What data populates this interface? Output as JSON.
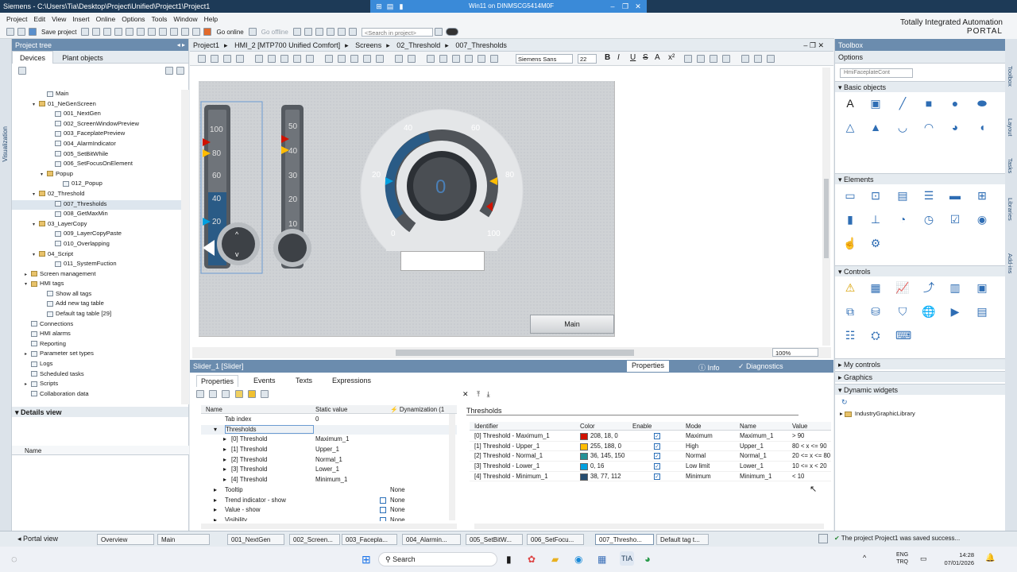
{
  "window": {
    "title": "Siemens - C:\\Users\\Tia\\Desktop\\Project\\Unified\\Project1\\Project1"
  },
  "remote": {
    "title": "Win11 on DINMSCG5414M0F"
  },
  "menu": [
    "Project",
    "Edit",
    "View",
    "Insert",
    "Online",
    "Options",
    "Tools",
    "Window",
    "Help"
  ],
  "toolbar": {
    "save": "Save project",
    "go_online": "Go online",
    "go_offline": "Go offline",
    "search_placeholder": "<Search in project>"
  },
  "brand": {
    "line1": "Totally Integrated Automation",
    "line2": "PORTAL"
  },
  "left_rail": {
    "label": "Visualization"
  },
  "project_tree": {
    "header": "Project tree",
    "tabs": [
      "Devices",
      "Plant objects"
    ],
    "items": [
      {
        "label": "Main",
        "indent": 5
      },
      {
        "label": "01_NeGenScreen",
        "indent": 4,
        "folder": true,
        "exp": "▾"
      },
      {
        "label": "001_NextGen",
        "indent": 6
      },
      {
        "label": "002_ScreenWindowPreview",
        "indent": 6
      },
      {
        "label": "003_FaceplatePreview",
        "indent": 6
      },
      {
        "label": "004_AlarmIndicator",
        "indent": 6
      },
      {
        "label": "005_SetBitWhile",
        "indent": 6
      },
      {
        "label": "006_SetFocusOnElement",
        "indent": 6
      },
      {
        "label": "Popup",
        "indent": 5,
        "folder": true,
        "exp": "▾"
      },
      {
        "label": "012_Popup",
        "indent": 7
      },
      {
        "label": "02_Threshold",
        "indent": 4,
        "folder": true,
        "exp": "▾"
      },
      {
        "label": "007_Thresholds",
        "indent": 6,
        "selected": true
      },
      {
        "label": "008_GetMaxMin",
        "indent": 6
      },
      {
        "label": "03_LayerCopy",
        "indent": 4,
        "folder": true,
        "exp": "▾"
      },
      {
        "label": "009_LayerCopyPaste",
        "indent": 6
      },
      {
        "label": "010_Overlapping",
        "indent": 6
      },
      {
        "label": "04_Script",
        "indent": 4,
        "folder": true,
        "exp": "▾"
      },
      {
        "label": "011_SystemFuction",
        "indent": 6
      },
      {
        "label": "Screen management",
        "indent": 3,
        "folder": true,
        "exp": "▸"
      },
      {
        "label": "HMI tags",
        "indent": 3,
        "folder": true,
        "exp": "▾"
      },
      {
        "label": "Show all tags",
        "indent": 5
      },
      {
        "label": "Add new tag table",
        "indent": 5
      },
      {
        "label": "Default tag table [29]",
        "indent": 5
      },
      {
        "label": "Connections",
        "indent": 3
      },
      {
        "label": "HMI alarms",
        "indent": 3
      },
      {
        "label": "Reporting",
        "indent": 3
      },
      {
        "label": "Parameter set types",
        "indent": 3,
        "exp": "▸"
      },
      {
        "label": "Logs",
        "indent": 3
      },
      {
        "label": "Scheduled tasks",
        "indent": 3
      },
      {
        "label": "Scripts",
        "indent": 3,
        "exp": "▸"
      },
      {
        "label": "Collaboration data",
        "indent": 3
      }
    ]
  },
  "details_view": {
    "header": "Details view",
    "col_name": "Name"
  },
  "breadcrumb": [
    "Project1",
    "HMI_2 [MTP700 Unified Comfort]",
    "Screens",
    "02_Threshold",
    "007_Thresholds"
  ],
  "editor_toolbar": {
    "font": "Siemens Sans",
    "size": "22",
    "zoom": "100%"
  },
  "canvas": {
    "bar1_ticks": [
      "100",
      "80",
      "60",
      "40",
      "20"
    ],
    "bar2_ticks": [
      "50",
      "40",
      "30",
      "20",
      "10"
    ],
    "gauge_ticks": [
      "0",
      "20",
      "40",
      "60",
      "80",
      "100"
    ],
    "gauge_value": "0",
    "main_button": "Main"
  },
  "properties": {
    "selection": "Slider_1 [Slider]",
    "top_tabs": [
      "Properties",
      "Info",
      "Diagnostics"
    ],
    "tabs": [
      "Properties",
      "Events",
      "Texts",
      "Expressions"
    ],
    "grid_headers": [
      "Name",
      "Static value",
      "Dynamization (1"
    ],
    "rows": [
      {
        "name": "Tab index",
        "value": "0",
        "indent": 0
      },
      {
        "name": "Thresholds",
        "value": "",
        "indent": 0,
        "exp": "▾",
        "selected": true
      },
      {
        "name": "[0] Threshold",
        "value": "Maximum_1",
        "indent": 1,
        "exp": "▸"
      },
      {
        "name": "[1] Threshold",
        "value": "Upper_1",
        "indent": 1,
        "exp": "▸"
      },
      {
        "name": "[2] Threshold",
        "value": "Normal_1",
        "indent": 1,
        "exp": "▸"
      },
      {
        "name": "[3] Threshold",
        "value": "Lower_1",
        "indent": 1,
        "exp": "▸"
      },
      {
        "name": "[4] Threshold",
        "value": "Minimum_1",
        "indent": 1,
        "exp": "▸"
      },
      {
        "name": "Tooltip",
        "value": "",
        "dyn": "None",
        "indent": 0,
        "exp": "▸"
      },
      {
        "name": "Trend indicator - show",
        "value": "",
        "dyn": "None",
        "check": true,
        "indent": 0,
        "exp": "▸"
      },
      {
        "name": "Value - show",
        "value": "",
        "dyn": "None",
        "check": true,
        "indent": 0,
        "exp": "▸"
      },
      {
        "name": "Visibility",
        "value": "",
        "dyn": "None",
        "check": true,
        "indent": 0,
        "exp": "▸"
      }
    ],
    "thresholds_title": "Thresholds",
    "th_headers": [
      "Identifier",
      "Color",
      "Enable",
      "Mode",
      "Name",
      "Value"
    ],
    "th_rows": [
      {
        "id": "[0] Threshold - Maximum_1",
        "color": "208, 18, 0",
        "hex": "#d01200",
        "mode": "Maximum",
        "name": "Maximum_1",
        "value": "> 90"
      },
      {
        "id": "[1] Threshold - Upper_1",
        "color": "255, 188, 0",
        "hex": "#ffbc00",
        "mode": "High",
        "name": "Upper_1",
        "value": "80 < x <= 90"
      },
      {
        "id": "[2] Threshold - Normal_1",
        "color": "36, 145, 150",
        "hex": "#249196",
        "mode": "Normal",
        "name": "Normal_1",
        "value": "20 <= x <= 80"
      },
      {
        "id": "[3] Threshold - Lower_1",
        "color": "0, 16",
        "hex": "#00a0e0",
        "mode": "Low limit",
        "name": "Lower_1",
        "value": "10 <= x < 20"
      },
      {
        "id": "[4] Threshold - Minimum_1",
        "color": "38, 77, 112",
        "hex": "#264d70",
        "mode": "Minimum",
        "name": "Minimum_1",
        "value": "< 10"
      }
    ]
  },
  "toolbox": {
    "header": "Toolbox",
    "options": "Options",
    "faceplate": "HmiFaceplateCont",
    "sections": [
      "Basic objects",
      "Elements",
      "Controls",
      "My controls",
      "Graphics",
      "Dynamic widgets"
    ],
    "library": "IndustryGraphicLibrary",
    "rail": [
      "Toolbox",
      "Layout",
      "Tasks",
      "Libraries",
      "Add-ins"
    ]
  },
  "status": {
    "portal": "Portal view",
    "tabs": [
      "Overview",
      "Main",
      "001_NextGen",
      "002_Screen...",
      "003_Facepla...",
      "004_Alarmin...",
      "005_SetBitW...",
      "006_SetFocu...",
      "007_Thresho...",
      "Default tag t..."
    ],
    "message": "The project Project1 was saved success..."
  },
  "taskbar": {
    "search": "Search",
    "lang1": "ENG",
    "lang2": "TRQ",
    "time": "14:28",
    "date": "07/01/2026"
  }
}
